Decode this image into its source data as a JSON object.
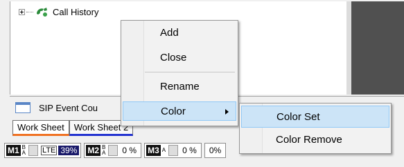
{
  "tree": {
    "call_history": "Call History"
  },
  "lower": {
    "sip_label": "SIP Event Cou"
  },
  "tabs": [
    {
      "label": "Work Sheet"
    },
    {
      "label": "Work Sheet 2"
    }
  ],
  "status": {
    "m1": {
      "badge": "M1",
      "b": "B",
      "a": "A",
      "net": "LTE",
      "pct": "39%"
    },
    "m2": {
      "badge": "M2",
      "b": "B",
      "a": "A",
      "pct": "0 %"
    },
    "m3": {
      "badge": "M3",
      "a": "A",
      "pct": "0 %"
    },
    "tail_pct": "0%"
  },
  "context_menu": {
    "items": [
      "Add",
      "Close",
      "Rename",
      "Color"
    ]
  },
  "color_submenu": {
    "items": [
      "Color Set",
      "Color Remove"
    ]
  },
  "colors": {
    "highlight": "#cce4f7",
    "tab_active_underline": "#f07020",
    "tab2_underline": "#2030d0",
    "dark_panel": "#505050"
  }
}
